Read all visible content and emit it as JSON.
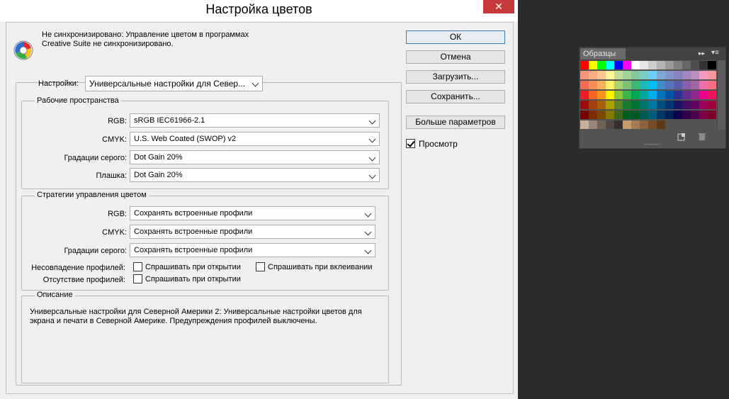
{
  "window": {
    "title": "Настройка цветов",
    "close_glyph": "✕"
  },
  "sync": {
    "line1": "Не синхронизировано: Управление цветом в программах",
    "line2": "Creative Suite не синхронизировано."
  },
  "settings": {
    "label": "Настройки:",
    "value": "Универсальные настройки для Север..."
  },
  "workspaces": {
    "title": "Рабочие пространства",
    "rgb_label": "RGB:",
    "rgb_value": "sRGB IEC61966-2.1",
    "cmyk_label": "CMYK:",
    "cmyk_value": "U.S. Web Coated (SWOP) v2",
    "gray_label": "Градации серого:",
    "gray_value": "Dot Gain 20%",
    "spot_label": "Плашка:",
    "spot_value": "Dot Gain 20%"
  },
  "policies": {
    "title": "Стратегии управления цветом",
    "rgb_label": "RGB:",
    "rgb_value": "Сохранять встроенные профили",
    "cmyk_label": "CMYK:",
    "cmyk_value": "Сохранять встроенные профили",
    "gray_label": "Градации серого:",
    "gray_value": "Сохранять встроенные профили",
    "mismatch_label": "Несовпадение профилей:",
    "ask_open": "Спрашивать при открытии",
    "ask_paste": "Спрашивать при вклеивании",
    "missing_label": "Отсутствие профилей:",
    "ask_open2": "Спрашивать при открытии"
  },
  "description": {
    "title": "Описание",
    "line1": "Универсальные настройки для Северной Америки 2:  Универсальные настройки цветов для",
    "line2": "экрана и печати в Северной Америке. Предупреждения профилей выключены."
  },
  "buttons": {
    "ok": "ОК",
    "cancel": "Отмена",
    "load": "Загрузить...",
    "save": "Сохранить...",
    "more": "Больше параметров"
  },
  "preview": {
    "label": "Просмотр",
    "checked": true
  },
  "swatches_panel": {
    "tab": "Образцы",
    "colors": [
      [
        "#ff0000",
        "#ffff00",
        "#00ff00",
        "#00ffff",
        "#0000ff",
        "#ff00ff",
        "#ffffff",
        "#e6e6e6",
        "#cccccc",
        "#b3b3b3",
        "#999999",
        "#808080",
        "#666666",
        "#4d4d4d",
        "#333333",
        "#000000"
      ],
      [
        "#f7977a",
        "#f9ad81",
        "#fdc68a",
        "#fff79a",
        "#c4df9b",
        "#a2d39c",
        "#82ca9d",
        "#7bcdc8",
        "#6ecff6",
        "#7ea7d8",
        "#8493ca",
        "#8882be",
        "#a187be",
        "#bc8dbf",
        "#f49ac2",
        "#f6989d"
      ],
      [
        "#f26c4f",
        "#f68e55",
        "#fbaf5c",
        "#fff467",
        "#acd372",
        "#7cc576",
        "#3bb878",
        "#1abbb4",
        "#00bff3",
        "#438ccb",
        "#5574b9",
        "#605ca8",
        "#855fa8",
        "#a763a8",
        "#f06ea9",
        "#f26d7d"
      ],
      [
        "#ed1c24",
        "#f26522",
        "#f7941d",
        "#fff200",
        "#8dc73f",
        "#39b54a",
        "#00a651",
        "#00a99d",
        "#00aeef",
        "#0072bc",
        "#0054a6",
        "#2e3192",
        "#662d91",
        "#92278f",
        "#ec008c",
        "#ed145b"
      ],
      [
        "#9e0b0f",
        "#a0410d",
        "#a36209",
        "#aba000",
        "#598527",
        "#1a7b30",
        "#007236",
        "#00746b",
        "#0076a3",
        "#004b80",
        "#003471",
        "#1b1464",
        "#440e62",
        "#630460",
        "#9e005d",
        "#9e0039"
      ],
      [
        "#790000",
        "#7b2e00",
        "#7d4900",
        "#827b00",
        "#406618",
        "#005e20",
        "#005826",
        "#005952",
        "#005b7f",
        "#003663",
        "#002157",
        "#0d004c",
        "#32004b",
        "#4b0049",
        "#7b0046",
        "#7a0026"
      ],
      [
        "#c7b299",
        "#998675",
        "#736357",
        "#534741",
        "#37302d",
        "#c69c6d",
        "#a67c52",
        "#8c6239",
        "#754c24",
        "#603913"
      ]
    ]
  }
}
